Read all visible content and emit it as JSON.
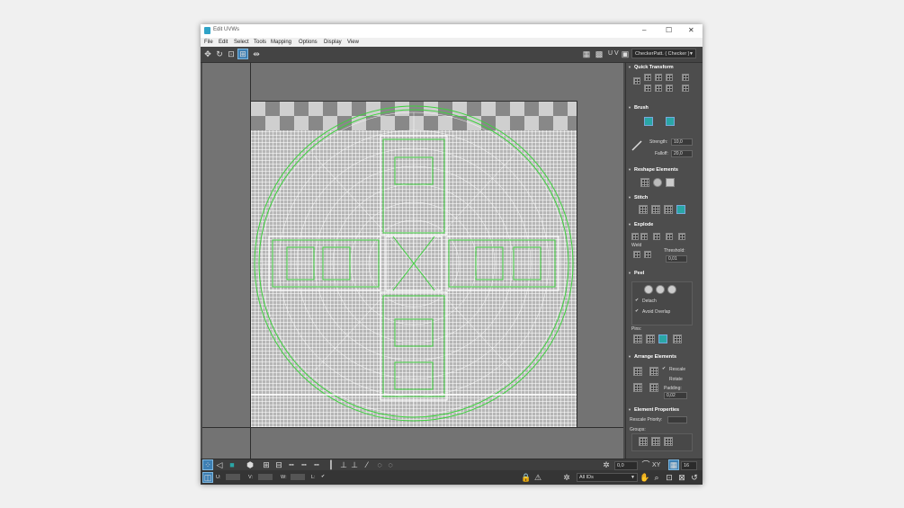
{
  "window": {
    "title": "Edit UVWs",
    "controls": [
      "–",
      "☐",
      "✕"
    ]
  },
  "menu": [
    "File",
    "Edit",
    "Select",
    "Tools",
    "Mapping",
    "Options",
    "Display",
    "View"
  ],
  "toolbar": {
    "uv_label": "U V",
    "map_combo": "CheckerPatt.  ( Checker )"
  },
  "panel": {
    "quick_transform": "Quick Transform",
    "brush": {
      "title": "Brush",
      "strength_label": "Strength:",
      "strength_value": "10,0",
      "falloff_label": "Falloff:",
      "falloff_value": "20,0"
    },
    "reshape": "Reshape Elements",
    "stitch": "Stitch",
    "explode": {
      "title": "Explode",
      "weld_label": "Weld",
      "threshold_label": "Threshold:",
      "threshold_value": "0,01"
    },
    "peel": {
      "title": "Peel",
      "detach": "Detach",
      "avoid_overlap": "Avoid Overlap",
      "pins": "Pins:"
    },
    "arrange": {
      "title": "Arrange Elements",
      "rescale": "Rescale",
      "rotate": "Rotate",
      "padding_label": "Padding:",
      "padding_value": "0,02"
    },
    "element_props": {
      "title": "Element Properties",
      "rescale_priority": "Rescale Priority:",
      "groups": "Groups:"
    }
  },
  "status": {
    "angle_value": "0,0",
    "xy_label": "XY",
    "grid_value": "16",
    "u_label": "U:",
    "v_label": "V:",
    "w_label": "W:",
    "l_label": "L:",
    "ids_combo": "All IDs"
  },
  "colors": {
    "wire": "#ffffff",
    "selection": "#3fd13f",
    "accent": "#3d7fb3",
    "panel_bg": "#4d4d4d"
  }
}
